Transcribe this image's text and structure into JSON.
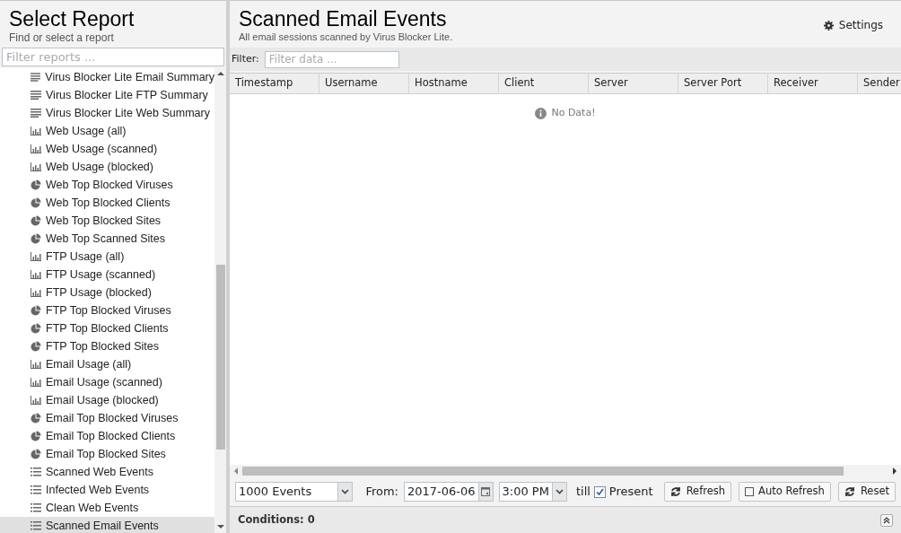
{
  "sidebar": {
    "title": "Select Report",
    "subtitle": "Find or select a report",
    "filter": {
      "placeholder": "Filter reports ..."
    },
    "items": [
      {
        "kind": "summary",
        "label": "Virus Blocker Lite Email Summary",
        "selected": false
      },
      {
        "kind": "summary",
        "label": "Virus Blocker Lite FTP Summary",
        "selected": false
      },
      {
        "kind": "summary",
        "label": "Virus Blocker Lite Web Summary",
        "selected": false
      },
      {
        "kind": "bar",
        "label": "Web Usage (all)",
        "selected": false
      },
      {
        "kind": "bar",
        "label": "Web Usage (scanned)",
        "selected": false
      },
      {
        "kind": "bar",
        "label": "Web Usage (blocked)",
        "selected": false
      },
      {
        "kind": "pie",
        "label": "Web Top Blocked Viruses",
        "selected": false
      },
      {
        "kind": "pie",
        "label": "Web Top Blocked Clients",
        "selected": false
      },
      {
        "kind": "pie",
        "label": "Web Top Blocked Sites",
        "selected": false
      },
      {
        "kind": "pie",
        "label": "Web Top Scanned Sites",
        "selected": false
      },
      {
        "kind": "bar",
        "label": "FTP Usage (all)",
        "selected": false
      },
      {
        "kind": "bar",
        "label": "FTP Usage (scanned)",
        "selected": false
      },
      {
        "kind": "bar",
        "label": "FTP Usage (blocked)",
        "selected": false
      },
      {
        "kind": "pie",
        "label": "FTP Top Blocked Viruses",
        "selected": false
      },
      {
        "kind": "pie",
        "label": "FTP Top Blocked Clients",
        "selected": false
      },
      {
        "kind": "pie",
        "label": "FTP Top Blocked Sites",
        "selected": false
      },
      {
        "kind": "bar",
        "label": "Email Usage (all)",
        "selected": false
      },
      {
        "kind": "bar",
        "label": "Email Usage (scanned)",
        "selected": false
      },
      {
        "kind": "bar",
        "label": "Email Usage (blocked)",
        "selected": false
      },
      {
        "kind": "pie",
        "label": "Email Top Blocked Viruses",
        "selected": false
      },
      {
        "kind": "pie",
        "label": "Email Top Blocked Clients",
        "selected": false
      },
      {
        "kind": "pie",
        "label": "Email Top Blocked Sites",
        "selected": false
      },
      {
        "kind": "list",
        "label": "Scanned Web Events",
        "selected": false
      },
      {
        "kind": "list",
        "label": "Infected Web Events",
        "selected": false
      },
      {
        "kind": "list",
        "label": "Clean Web Events",
        "selected": false
      },
      {
        "kind": "list",
        "label": "Scanned Email Events",
        "selected": true
      }
    ]
  },
  "report": {
    "title": "Scanned Email Events",
    "description": "All email sessions scanned by Virus Blocker Lite.",
    "settings": "Settings",
    "filter": {
      "label": "Filter:",
      "placeholder": "Filter data ..."
    },
    "table": {
      "columns": [
        "Timestamp",
        "Username",
        "Hostname",
        "Client",
        "Server",
        "Server Port",
        "Receiver",
        "Sender"
      ],
      "empty": "No Data!"
    },
    "toolbar": {
      "limit": "1000 Events",
      "from_label": "From:",
      "date": "2017-06-06",
      "time": "3:00 PM",
      "till": "till",
      "present": {
        "label": "Present",
        "checked": true
      },
      "refresh": "Refresh",
      "auto_refresh": {
        "label": "Auto Refresh",
        "on": false
      },
      "reset": "Reset"
    },
    "conditions": "Conditions: 0"
  }
}
